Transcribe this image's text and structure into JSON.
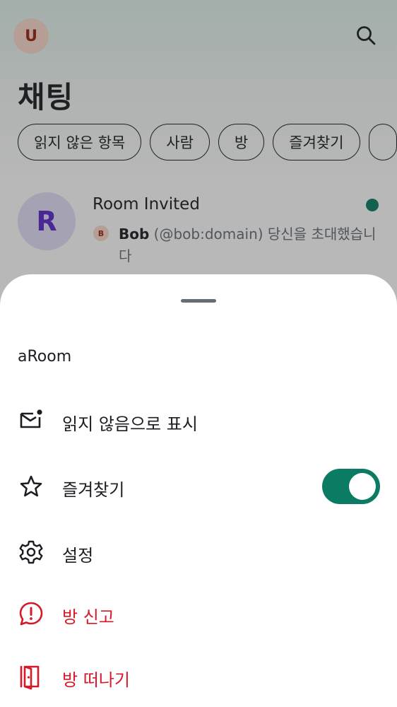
{
  "app": {
    "user_initial": "U",
    "title": "채팅",
    "filters": [
      "읽지 않은 항목",
      "사람",
      "방",
      "즐겨찾기"
    ],
    "room": {
      "initial": "R",
      "name": "Room Invited",
      "inviter_initial": "B",
      "inviter_name": "Bob",
      "invite_text": " (@bob:domain) 당신을 초대했습니다"
    }
  },
  "sheet": {
    "room_name": "aRoom",
    "items": [
      {
        "label": "읽지 않음으로 표시",
        "icon": "mark-unread-icon"
      },
      {
        "label": "즐겨찾기",
        "icon": "star-icon",
        "toggle_on": true
      },
      {
        "label": "설정",
        "icon": "settings-gear-icon"
      },
      {
        "label": "방 신고",
        "icon": "report-icon",
        "danger": true
      },
      {
        "label": "방 떠나기",
        "icon": "leave-door-icon",
        "danger": true
      }
    ]
  },
  "colors": {
    "accent": "#0b7c63",
    "danger": "#d51928",
    "text": "#1b1d22",
    "muted": "#656d77"
  }
}
